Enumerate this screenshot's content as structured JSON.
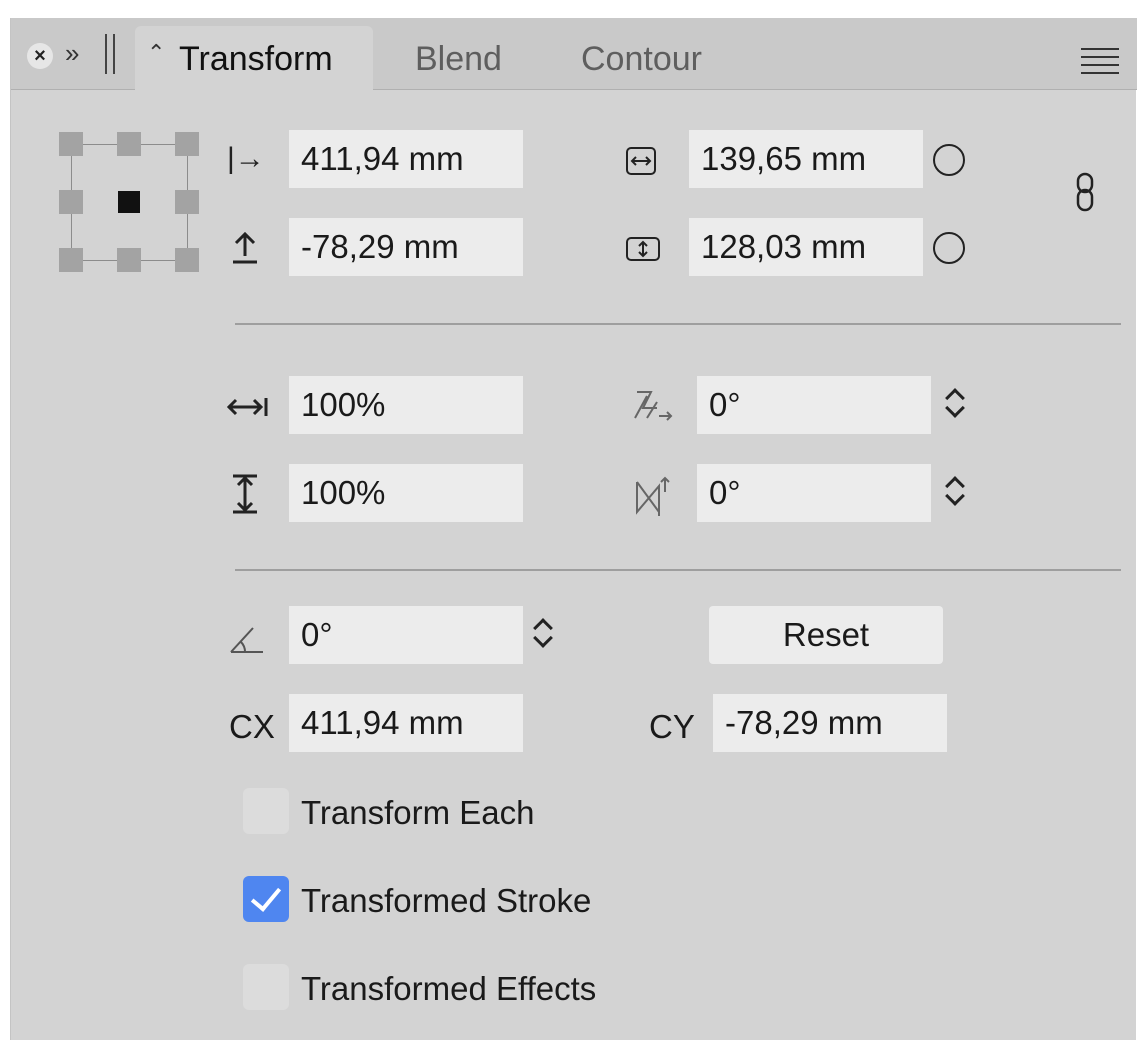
{
  "tabbar": {
    "close_glyph": "×",
    "expand_glyph": "»",
    "tabs": [
      {
        "label": "Transform",
        "active": true
      },
      {
        "label": "Blend",
        "active": false
      },
      {
        "label": "Contour",
        "active": false
      }
    ]
  },
  "position": {
    "x_value": "411,94 mm",
    "y_value": "-78,29 mm"
  },
  "size": {
    "width_value": "139,65 mm",
    "height_value": "128,03 mm",
    "proportions_locked": false
  },
  "scale": {
    "horizontal_value": "100%",
    "vertical_value": "100%"
  },
  "skew": {
    "horizontal_value": "0°",
    "vertical_value": "0°"
  },
  "rotation": {
    "angle_value": "0°",
    "reset_label": "Reset"
  },
  "center": {
    "cx_label": "CX",
    "cx_value": "411,94 mm",
    "cy_label": "CY",
    "cy_value": "-78,29 mm"
  },
  "options": [
    {
      "label": "Transform Each",
      "checked": false
    },
    {
      "label": "Transformed Stroke",
      "checked": true
    },
    {
      "label": "Transformed Effects",
      "checked": false
    }
  ],
  "colors": {
    "panel_bg": "#d3d3d3",
    "field_bg": "#ececec",
    "checkbox_accent": "#4f86f0"
  }
}
